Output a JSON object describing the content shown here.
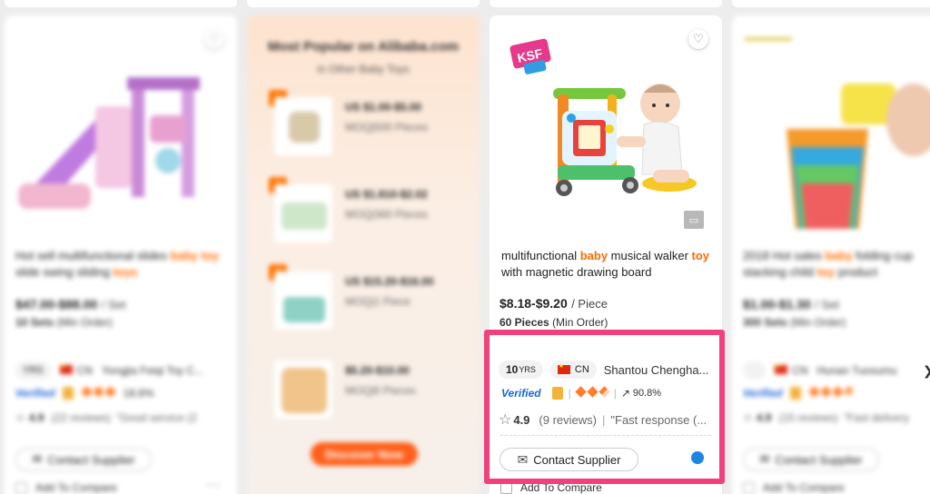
{
  "colors": {
    "accent": "#ff6a00",
    "highlight_border": "#f1407a",
    "verified": "#1a66d8"
  },
  "cards": [
    {
      "title_pre": "Hot sell multifunctional slides ",
      "title_hl1": "baby toy",
      "title_mid": " slide swing sliding ",
      "title_hl2": "toys",
      "price": "$47.00-$88.00",
      "unit": "/ Set",
      "moq_value": "10 Sets",
      "moq_label": "(Min Order)",
      "years": "YRS",
      "country": "CN",
      "supplier": "Yongjia Feiqi Toy C...",
      "verified": "Verified",
      "rate": "18.6%",
      "rating": "4.9",
      "reviews": "(22 reviews)",
      "review_snippet": "\"Good service (2",
      "contact": "Contact Supplier",
      "compare": "Add To Compare"
    },
    {
      "heading": "Most Popular on Alibaba.com",
      "subheading": "in Other Baby Toys",
      "items": [
        {
          "rank": "1",
          "price": "US $1.00-$5.00",
          "moq": "MOQ|500 Pieces"
        },
        {
          "rank": "2",
          "price": "US $1.810-$2.02",
          "moq": "MOQ|360 Pieces"
        },
        {
          "rank": "3",
          "price": "US $15.20-$16.00",
          "moq": "MOQ|1 Piece"
        },
        {
          "rank": "",
          "price": "$5.20-$10.00",
          "moq": "MOQ|6 Pieces"
        }
      ],
      "discover": "Discover Now"
    },
    {
      "title_pre": "multifunctional ",
      "title_hl1": "baby",
      "title_mid": " musical walker ",
      "title_hl2": "toy",
      "title_post": " with magnetic drawing board",
      "price": "$8.18-$9.20",
      "unit": "/ Piece",
      "moq_value": "60 Pieces",
      "moq_label": "(Min Order)",
      "years_num": "10",
      "years": "YRS",
      "country": "CN",
      "supplier": "Shantou Chengha...",
      "verified": "Verified",
      "rate": "90.8%",
      "rating": "4.9",
      "reviews": "(9 reviews)",
      "review_snippet": "\"Fast response (...",
      "contact": "Contact Supplier",
      "compare": "Add To Compare"
    },
    {
      "title_pre": "2018 Hot sales ",
      "title_hl1": "baby",
      "title_mid": " folding cup stacking child ",
      "title_hl2": "toy",
      "title_post": " product",
      "price": "$1.00-$1.30",
      "unit": "/ Set",
      "moq_value": "300 Sets",
      "moq_label": "(Min Order)",
      "country": "CN",
      "supplier": "Hunan Tuosumu",
      "verified": "Verified",
      "rating": "4.9",
      "reviews": "(15 reviews)",
      "review_snippet": "\"Fast delivery",
      "contact": "Contact Supplier",
      "compare": "Add To Compare"
    }
  ]
}
